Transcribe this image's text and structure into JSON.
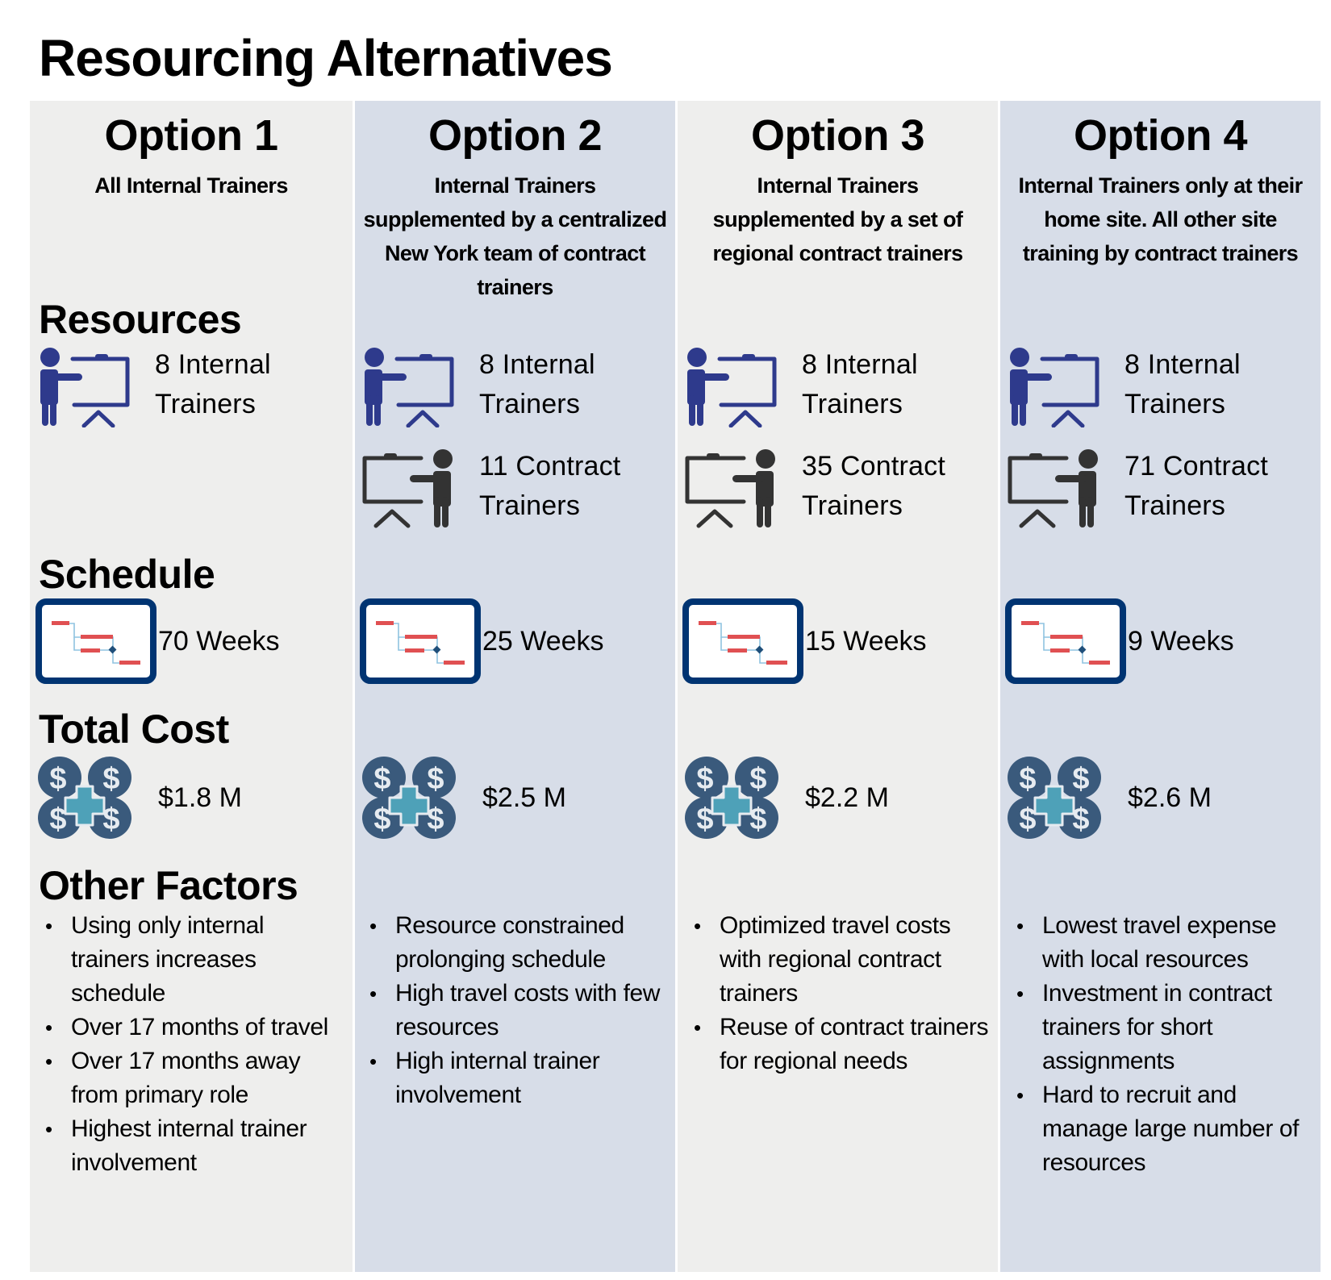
{
  "page": {
    "title": "Resourcing Alternatives"
  },
  "sections": {
    "resources": "Resources",
    "schedule": "Schedule",
    "total_cost": "Total Cost",
    "other_factors": "Other Factors"
  },
  "icons": {
    "internal_trainer": "presenter-board-icon",
    "contract_trainer": "presenter-board-icon",
    "schedule": "gantt-chart-icon",
    "cost": "money-plus-icon"
  },
  "colors": {
    "internal_trainer_icon": "#2e3a8c",
    "contract_trainer_icon": "#333333",
    "gantt_frame": "#003472",
    "gantt_bar": "#e05052",
    "cost_coin": "#3a5a7c",
    "cost_plus": "#4ea1b8",
    "panel_grey": "#eeeeed",
    "panel_blue": "#d7dde8"
  },
  "options": [
    {
      "title": "Option 1",
      "subtitle": "All Internal Trainers",
      "internal": "8 Internal Trainers",
      "internal_count": "8 Internal",
      "internal_label": "Trainers",
      "contract_count": null,
      "contract_label": null,
      "schedule": "70 Weeks",
      "cost": "$1.8 M",
      "factors": [
        "Using only internal trainers increases schedule",
        "Over 17 months of travel",
        "Over 17 months away from primary role",
        "Highest internal trainer involvement"
      ]
    },
    {
      "title": "Option 2",
      "subtitle": "Internal Trainers supplemented by a centralized New York team of contract trainers",
      "internal_count": "8 Internal",
      "internal_label": "Trainers",
      "contract_count": "11 Contract",
      "contract_label": "Trainers",
      "schedule": "25 Weeks",
      "cost": "$2.5 M",
      "factors": [
        "Resource constrained prolonging schedule",
        "High travel costs with few resources",
        "High internal trainer involvement"
      ]
    },
    {
      "title": "Option 3",
      "subtitle": "Internal Trainers supplemented by a set of regional contract trainers",
      "internal_count": "8 Internal",
      "internal_label": "Trainers",
      "contract_count": "35 Contract",
      "contract_label": "Trainers",
      "schedule": "15 Weeks",
      "cost": "$2.2 M",
      "factors": [
        "Optimized travel costs with regional contract trainers",
        "Reuse of contract trainers for regional needs"
      ]
    },
    {
      "title": "Option 4",
      "subtitle": "Internal Trainers only at their home site.  All other site training by contract trainers",
      "internal_count": "8 Internal",
      "internal_label": "Trainers",
      "contract_count": "71 Contract",
      "contract_label": "Trainers",
      "schedule": "9 Weeks",
      "cost": "$2.6 M",
      "factors": [
        "Lowest travel expense with local resources",
        "Investment in contract trainers for short assignments",
        "Hard to recruit and manage large number of resources"
      ]
    }
  ]
}
